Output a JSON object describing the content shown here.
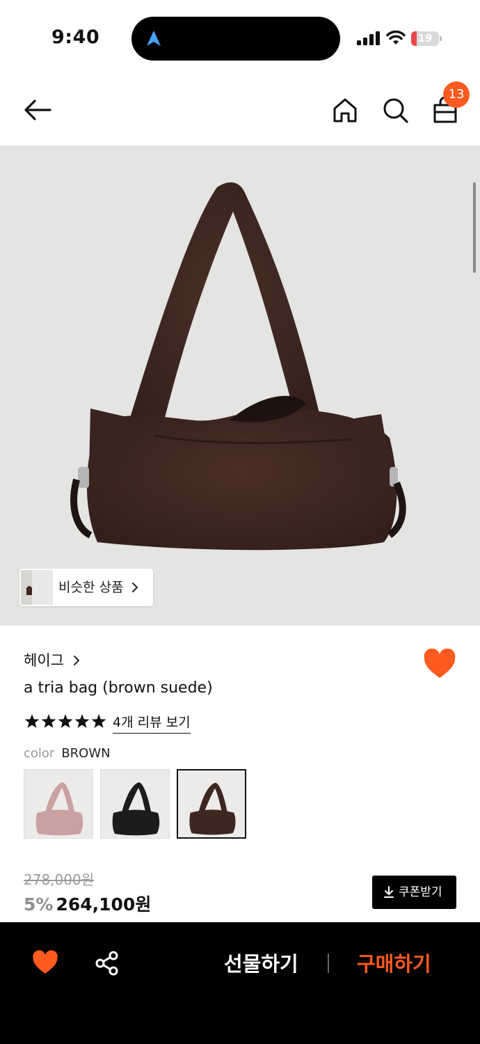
{
  "status_bar": {
    "time": "9:40",
    "battery_level": "19",
    "battery_fraction": 0.19,
    "icons": [
      "navigation-arrow-icon",
      "cellular-signal-icon",
      "wifi-icon",
      "battery-icon"
    ]
  },
  "header": {
    "back_icon": "arrow-left-icon",
    "home_icon": "home-icon",
    "search_icon": "search-icon",
    "cart_icon": "shopping-bag-icon",
    "cart_count": "13"
  },
  "hero": {
    "similar_label": "비슷한 상품"
  },
  "product": {
    "brand": "헤이그",
    "name": "a tria bag (brown suede)",
    "rating_stars": 5,
    "review_link": "4개 리뷰 보기",
    "color_label": "color",
    "color_value": "BROWN",
    "swatches": [
      "pink",
      "black",
      "brown"
    ],
    "selected_swatch": "brown",
    "original_price": "278,000원",
    "discount": "5%",
    "final_price": "264,100원",
    "coupon_label": "쿠폰받기"
  },
  "bottom_bar": {
    "gift_label": "선물하기",
    "buy_label": "구매하기"
  },
  "colors": {
    "accent": "#ff5a1f",
    "background": "#ffffff",
    "bottom_bar": "#000000",
    "brown_bag": "#3e2621",
    "pink_bag": "#c9a1a1",
    "black_bag": "#1c1c1c"
  }
}
